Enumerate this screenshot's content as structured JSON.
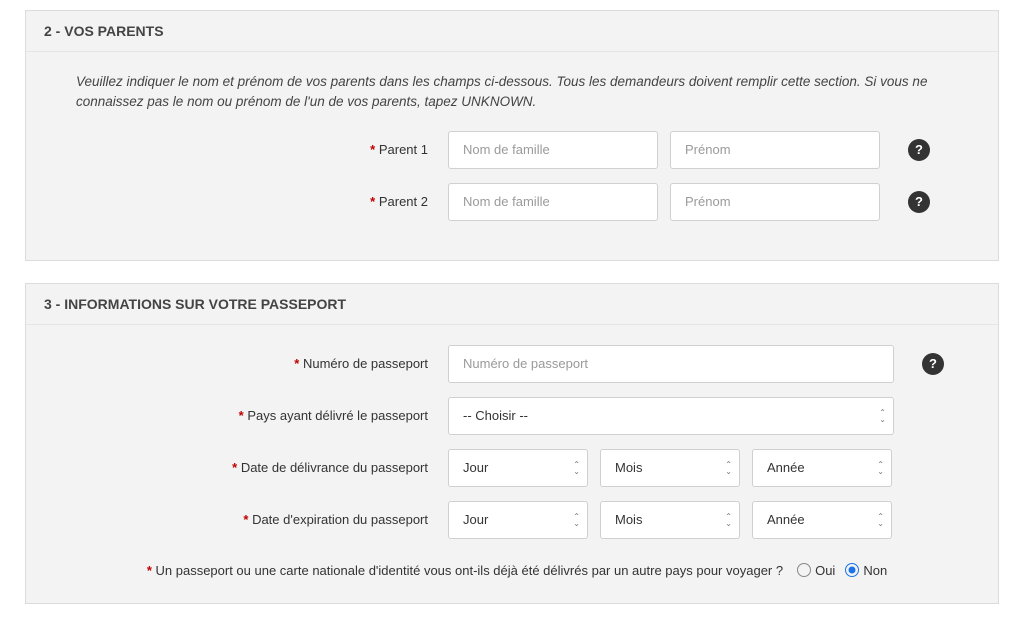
{
  "section2": {
    "title": "2 - VOS PARENTS",
    "intro": "Veuillez indiquer le nom et prénom de vos parents dans les champs ci-dessous. Tous les demandeurs doivent remplir cette section. Si vous ne connaissez pas le nom ou prénom de l'un de vos parents, tapez UNKNOWN.",
    "parent1_label": "Parent 1",
    "parent2_label": "Parent 2",
    "lastname_ph": "Nom de famille",
    "firstname_ph": "Prénom"
  },
  "section3": {
    "title": "3 - INFORMATIONS SUR VOTRE PASSEPORT",
    "passport_number_label": "Numéro de passeport",
    "passport_number_ph": "Numéro de passeport",
    "issuing_country_label": "Pays ayant délivré le passeport",
    "choose_option": "-- Choisir --",
    "issue_date_label": "Date de délivrance du passeport",
    "expiry_date_label": "Date d'expiration du passeport",
    "day_option": "Jour",
    "month_option": "Mois",
    "year_option": "Année",
    "question": "Un passeport ou une carte nationale d'identité vous ont-ils déjà été délivrés par un autre pays pour voyager ?",
    "yes_label": "Oui",
    "no_label": "Non"
  },
  "help_glyph": "?"
}
